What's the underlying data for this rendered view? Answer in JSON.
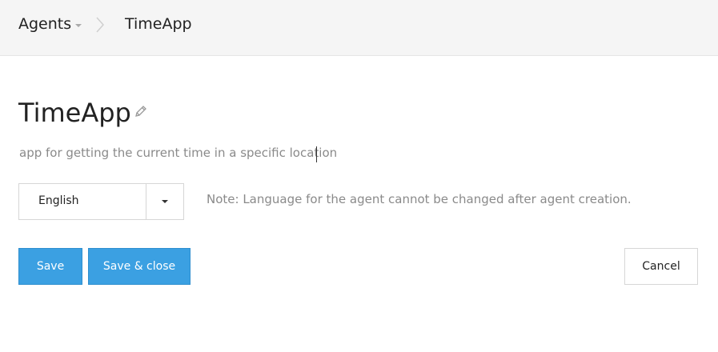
{
  "breadcrumb": {
    "root": "Agents",
    "current": "TimeApp"
  },
  "agent": {
    "name": "TimeApp",
    "description": "app for getting the current time in a specific location"
  },
  "language": {
    "selected": "English",
    "note": "Note: Language for the agent cannot be changed after agent creation."
  },
  "actions": {
    "save": "Save",
    "save_close": "Save & close",
    "cancel": "Cancel"
  },
  "colors": {
    "primary": "#3ba0e2",
    "header_bg": "#f5f5f5"
  },
  "icons": {
    "edit": "pencil-icon",
    "breadcrumb_separator": "chevron-right-icon",
    "dropdown": "caret-down-icon"
  }
}
